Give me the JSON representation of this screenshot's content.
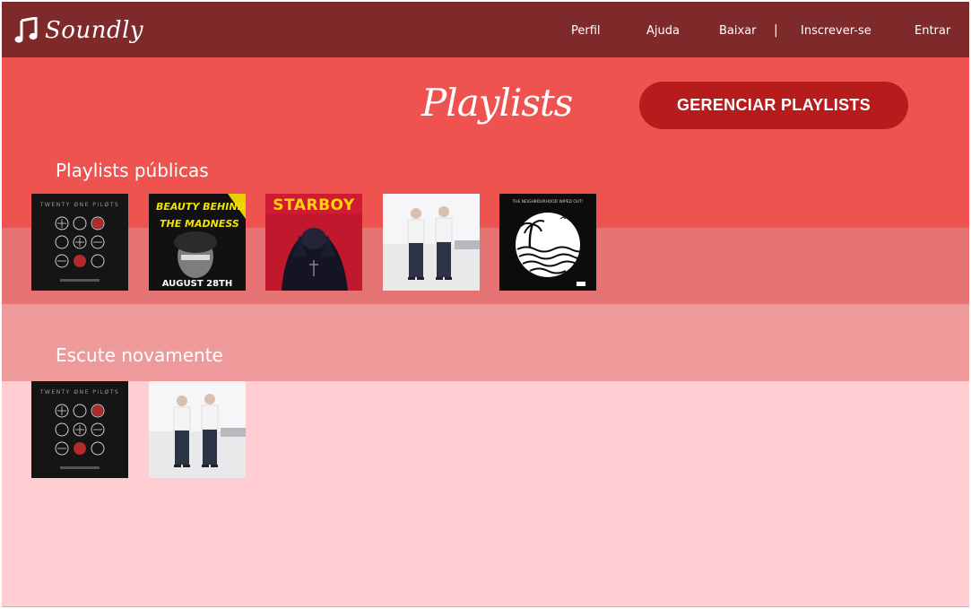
{
  "app": {
    "brand_name": "Soundly"
  },
  "nav": {
    "links": [
      "Perfil",
      "Ajuda",
      "Baixar",
      "Inscrever-se",
      "Entrar"
    ],
    "separator": "|"
  },
  "main": {
    "title": "Playlists",
    "manage_button_label": "GERENCIAR PLAYLISTS",
    "sections": [
      {
        "heading": "Playlists públicas",
        "covers": [
          {
            "icon": "blurryface-album-art",
            "text": "TWENTY ØNE PILØTS"
          },
          {
            "icon": "beauty-behind-the-madness-album-art",
            "text": [
              "BEAUTY BEHIND",
              "THE MADNESS",
              "AUGUST 28TH"
            ]
          },
          {
            "icon": "starboy-album-art",
            "text": "STARBOY"
          },
          {
            "icon": "vessel-album-art",
            "text": ""
          },
          {
            "icon": "wiped-out-album-art",
            "text": "THE NEIGHBOURHOOD WIPED OUT!"
          }
        ]
      },
      {
        "heading": "Escute novamente",
        "covers": [
          {
            "icon": "blurryface-album-art",
            "text": "TWENTY ØNE PILØTS"
          },
          {
            "icon": "vessel-album-art",
            "text": ""
          }
        ]
      }
    ]
  },
  "colors": {
    "header": "#7f2a2a",
    "hero": "#ef5350",
    "strip": "#e57373",
    "second": "#ef9a9a",
    "bottom": "#ffcdd2",
    "button": "#b71c1c"
  }
}
